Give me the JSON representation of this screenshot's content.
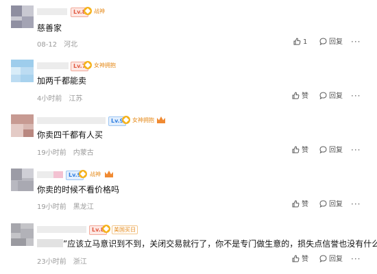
{
  "comments": [
    {
      "level": "Lv.8",
      "badge": "战神",
      "text": "慈善家",
      "date": "08-12",
      "location": "河北",
      "like_label": "1",
      "reply_label": "回复",
      "more": "···"
    },
    {
      "level": "Lv.7",
      "badge": "女神拥抱",
      "text": "加两千都能卖",
      "date": "4小时前",
      "location": "江苏",
      "like_label": "赞",
      "reply_label": "回复",
      "more": "···"
    },
    {
      "level": "Lv.9",
      "badge": "女神拥抱",
      "text": "你卖四千都有人买",
      "date": "19小时前",
      "location": "内蒙古",
      "like_label": "赞",
      "reply_label": "回复",
      "more": "···"
    },
    {
      "level": "Lv.9",
      "badge": "战神",
      "text": "你卖的时候不看价格吗",
      "date": "19小时前",
      "location": "黑龙江",
      "like_label": "赞",
      "reply_label": "回复",
      "more": "···"
    },
    {
      "level": "Lv.8",
      "badge": "美国买日",
      "text": "”应该立马意识到不到，关闭交易就行了，你不是专门做生意的，损失点信誉也没有什么",
      "date": "23小时前",
      "location": "浙江",
      "like_label": "赞",
      "reply_label": "回复",
      "more": "···"
    }
  ]
}
